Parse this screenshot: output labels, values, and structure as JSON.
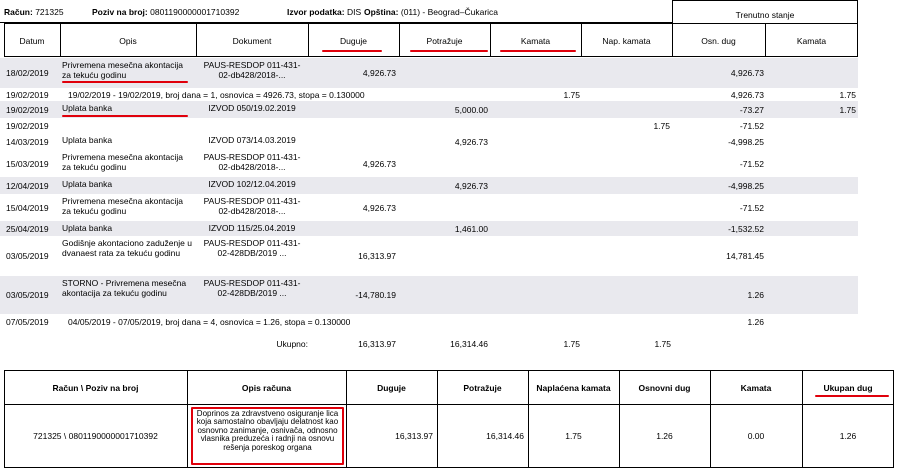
{
  "header": {
    "racun_label": "Račun:",
    "racun_value": "721325",
    "poziv_label": "Poziv na broj:",
    "poziv_value": "0801190000001710392",
    "izvor_label": "Izvor podatka:",
    "izvor_value": "DIS",
    "opstina_label": "Opština:",
    "opstina_value": "(011) - Beograd–Čukarica",
    "trenutno_stanje": "Trenutno stanje"
  },
  "columns": {
    "datum": "Datum",
    "opis": "Opis",
    "dokument": "Dokument",
    "duguje": "Duguje",
    "potrazuje": "Potražuje",
    "kamata": "Kamata",
    "nap_kamata": "Nap. kamata",
    "osn_dug": "Osn. dug",
    "kamata2": "Kamata"
  },
  "rows": [
    {
      "datum": "18/02/2019",
      "opis": "Privremena mesečna akontacija za tekuću godinu",
      "dok": "PAUS-RESDOP 011-431-02-db428/2018-...",
      "duguje": "4,926.73",
      "potrazuje": "",
      "kamata": "",
      "nap": "",
      "osn": "4,926.73",
      "kam2": ""
    },
    {
      "datum": "19/02/2019",
      "span": "19/02/2019 - 19/02/2019, broj dana = 1, osnovica = 4926.73, stopa = 0.130000",
      "kamata": "1.75",
      "osn": "4,926.73",
      "kam2": "1.75"
    },
    {
      "datum": "19/02/2019",
      "opis": "Uplata banka",
      "dok": "IZVOD 050/19.02.2019",
      "duguje": "",
      "potrazuje": "5,000.00",
      "kamata": "",
      "nap": "",
      "osn": "-73.27",
      "kam2": "1.75"
    },
    {
      "datum": "19/02/2019",
      "opis": "",
      "dok": "",
      "duguje": "",
      "potrazuje": "",
      "kamata": "",
      "nap": "1.75",
      "osn": "-71.52",
      "kam2": ""
    },
    {
      "datum": "14/03/2019",
      "opis": "Uplata banka",
      "dok": "IZVOD 073/14.03.2019",
      "duguje": "",
      "potrazuje": "4,926.73",
      "kamata": "",
      "nap": "",
      "osn": "-4,998.25",
      "kam2": ""
    },
    {
      "datum": "15/03/2019",
      "opis": "Privremena mesečna akontacija za tekuću godinu",
      "dok": "PAUS-RESDOP 011-431-02-db428/2018-...",
      "duguje": "4,926.73",
      "potrazuje": "",
      "kamata": "",
      "nap": "",
      "osn": "-71.52",
      "kam2": ""
    },
    {
      "datum": "12/04/2019",
      "opis": "Uplata banka",
      "dok": "IZVOD 102/12.04.2019",
      "duguje": "",
      "potrazuje": "4,926.73",
      "kamata": "",
      "nap": "",
      "osn": "-4,998.25",
      "kam2": ""
    },
    {
      "datum": "15/04/2019",
      "opis": "Privremena mesečna akontacija za tekuću godinu",
      "dok": "PAUS-RESDOP 011-431-02-db428/2018-...",
      "duguje": "4,926.73",
      "potrazuje": "",
      "kamata": "",
      "nap": "",
      "osn": "-71.52",
      "kam2": ""
    },
    {
      "datum": "25/04/2019",
      "opis": "Uplata banka",
      "dok": "IZVOD 115/25.04.2019",
      "duguje": "",
      "potrazuje": "1,461.00",
      "kamata": "",
      "nap": "",
      "osn": "-1,532.52",
      "kam2": ""
    },
    {
      "datum": "03/05/2019",
      "opis": "Godišnje akontaciono zaduženje u dvanaest rata za tekuću godinu",
      "dok": "PAUS-RESDOP 011-431-02-428DB/2019 ...",
      "duguje": "16,313.97",
      "potrazuje": "",
      "kamata": "",
      "nap": "",
      "osn": "14,781.45",
      "kam2": ""
    },
    {
      "datum": "03/05/2019",
      "opis": "STORNO - Privremena mesečna akontacija za tekuću godinu",
      "dok": "PAUS-RESDOP 011-431-02-428DB/2019 ...",
      "duguje": "-14,780.19",
      "potrazuje": "",
      "kamata": "",
      "nap": "",
      "osn": "1.26",
      "kam2": ""
    },
    {
      "datum": "07/05/2019",
      "span": "04/05/2019 - 07/05/2019, broj dana = 4, osnovica = 1.26, stopa = 0.130000",
      "kamata": "",
      "osn": "1.26",
      "kam2": ""
    }
  ],
  "totals": {
    "label": "Ukupno:",
    "duguje": "16,313.97",
    "potrazuje": "16,314.46",
    "kamata": "1.75",
    "nap": "1.75"
  },
  "summary": {
    "headers": {
      "racun": "Račun \\ Poziv na broj",
      "opis": "Opis računa",
      "duguje": "Duguje",
      "potrazuje": "Potražuje",
      "naplacena": "Naplaćena kamata",
      "osnovni": "Osnovni dug",
      "kamata": "Kamata",
      "ukupan": "Ukupan dug"
    },
    "values": {
      "racun": "721325 \\ 0801190000001710392",
      "opis": "Doprinos za zdravstveno osiguranje lica koja samostalno obavljaju delatnost kao osnovno zanimanje, osnivača, odnosno vlasnika preduzeća i radnji na osnovu rešenja poreskog organa",
      "duguje": "16,313.97",
      "potrazuje": "16,314.46",
      "naplacena": "1.75",
      "osnovni": "1.26",
      "kamata": "0.00",
      "ukupan": "1.26"
    }
  },
  "colors": {
    "highlight": "#e0000b",
    "shade": "#e9e9ee"
  }
}
